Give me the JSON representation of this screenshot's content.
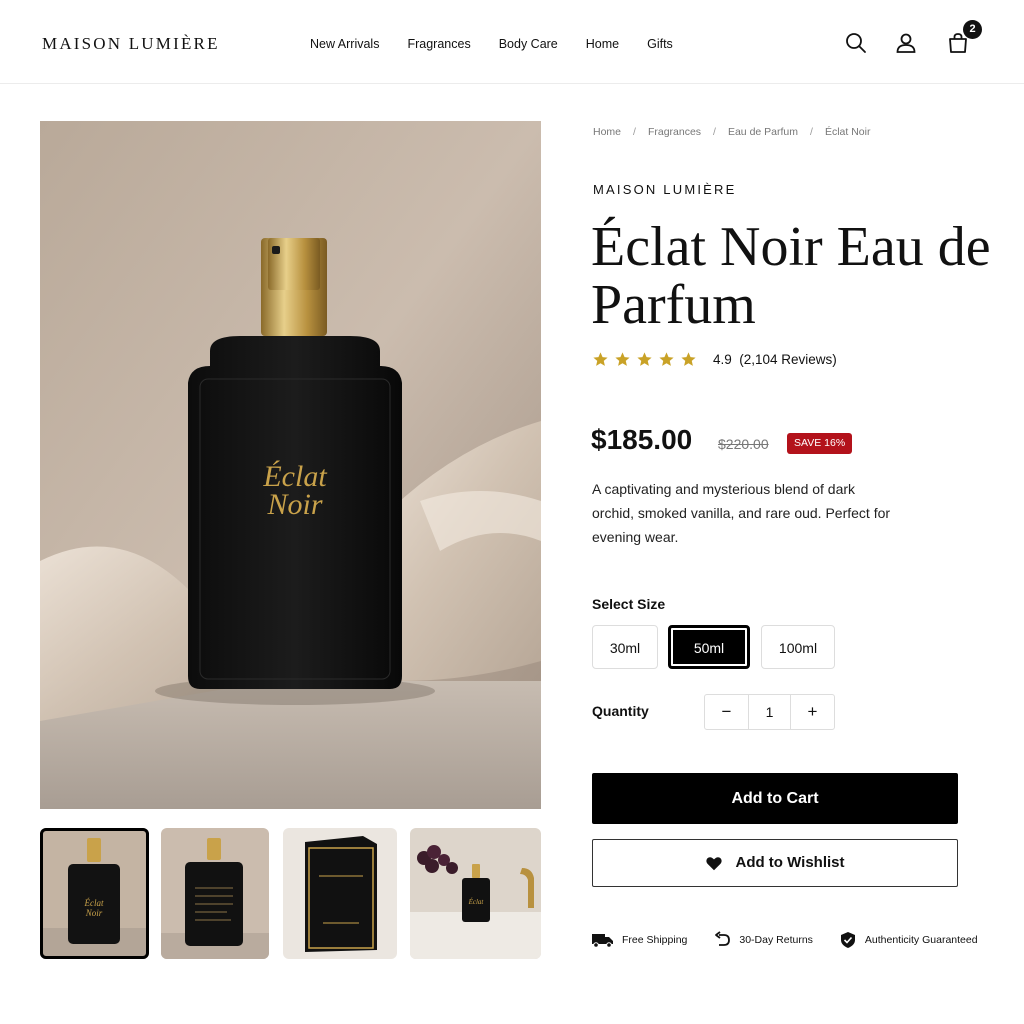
{
  "header": {
    "logo": "MAISON LUMIÈRE",
    "nav": [
      "New Arrivals",
      "Fragrances",
      "Body Care",
      "Home",
      "Gifts"
    ],
    "cart_count": "2",
    "icons": [
      "search-icon",
      "user-icon",
      "shopping-bag-icon"
    ]
  },
  "gallery": {
    "bottle_label_line1": "Éclat",
    "bottle_label_line2": "Noir",
    "thumbnails": [
      "bottle-front",
      "bottle-back",
      "gift-box",
      "bottle-on-vanity"
    ],
    "selected_thumbnail": 0
  },
  "breadcrumb": [
    "Home",
    "Fragrances",
    "Eau de Parfum",
    "Éclat Noir"
  ],
  "product": {
    "brand": "MAISON LUMIÈRE",
    "title": "Éclat Noir Eau de Parfum",
    "rating_value": 4.9,
    "rating_text": "4.9  (2,104 Reviews)",
    "stars": 5,
    "price": "$185.00",
    "old_price": "$220.00",
    "discount": "SAVE 16%",
    "description": "A captivating and mysterious blend of dark orchid, smoked vanilla, and rare oud. Perfect for evening wear."
  },
  "size": {
    "label": "Select Size",
    "options": [
      "30ml",
      "50ml",
      "100ml"
    ],
    "selected": "50ml"
  },
  "quantity": {
    "label": "Quantity",
    "value": "1",
    "minus": "−",
    "plus": "+"
  },
  "actions": {
    "add_to_cart": "Add to Cart",
    "wishlist": "Add to Wishlist"
  },
  "features": [
    "Free Shipping",
    "30-Day Returns",
    "Authenticity Guaranteed"
  ],
  "colors": {
    "accent": "#000000",
    "star": "#c9a227",
    "sale": "#b3121b",
    "gold": "#c9a24a"
  }
}
